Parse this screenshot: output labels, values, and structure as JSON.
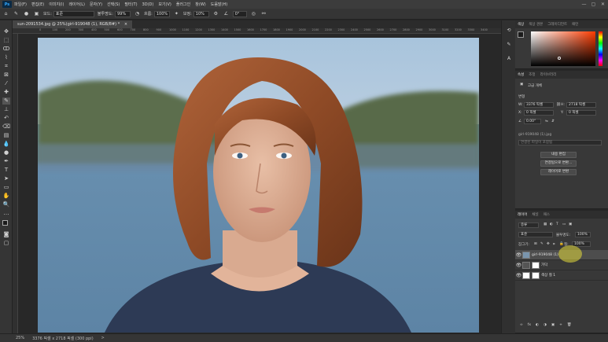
{
  "app": {
    "logo": "Ps"
  },
  "menubar": {
    "items": [
      "파일(F)",
      "편집(E)",
      "이미지(I)",
      "레이어(L)",
      "문자(Y)",
      "선택(S)",
      "필터(T)",
      "3D(D)",
      "보기(V)",
      "플러그인",
      "창(W)",
      "도움말(H)"
    ],
    "window_controls": [
      "—",
      "▢",
      "✕"
    ]
  },
  "optionsbar": {
    "mode_label": "모드:",
    "mode_value": "표준",
    "opacity_label": "불투명도:",
    "opacity_value": "99%",
    "flow_label": "흐름:",
    "flow_value": "100%",
    "smoothing_label": "보정:",
    "smoothing_value": "10%",
    "angle_value": "0°"
  },
  "document": {
    "tab_title": "sun-2091534.jpg @ 25%(girl-919048 (1), RGB/8#) *",
    "tab_close": "×",
    "ruler_ticks": [
      "0",
      "100",
      "200",
      "300",
      "400",
      "500",
      "600",
      "700",
      "800",
      "900",
      "1000",
      "1100",
      "1200",
      "1300",
      "1400",
      "1500",
      "1600",
      "1700",
      "1800",
      "1900",
      "2000",
      "2100",
      "2200",
      "2300",
      "2400",
      "2500",
      "2600",
      "2700",
      "2800",
      "2900",
      "3000",
      "3100",
      "3200",
      "3300",
      "3400"
    ]
  },
  "status": {
    "zoom": "25%",
    "doc_info": "3376 픽셀 x 2718 픽셀 (300 ppi)",
    "arrow": ">"
  },
  "color_panel": {
    "tabs": [
      "색상",
      "색상 견본",
      "그레이디언트",
      "패턴"
    ],
    "active_tab": 0,
    "hue_colors": [
      "#ff0000",
      "#ffff00",
      "#00ff00",
      "#00ffff",
      "#0000ff",
      "#ff00ff",
      "#ff0000"
    ],
    "base_hue": "#ff3b00",
    "fg_color": "#1a1a1a",
    "bg_color": "#8b2e1a"
  },
  "properties_panel": {
    "tabs": [
      "속성",
      "조정",
      "라이브러리"
    ],
    "active_tab": 0,
    "object_type": "고급 개체",
    "section_label": "변형",
    "w_label": "W:",
    "w_value": "3376 픽셀",
    "h_label": "H:",
    "h_value": "2718 픽셀",
    "x_label": "X:",
    "x_value": "0 픽셀",
    "y_label": "Y:",
    "y_value": "0 픽셀",
    "angle_value": "0.00°",
    "file_label": "girl-919048 (1).jpg",
    "embed_note": "연결된 파일이 포함됨",
    "buttons": [
      "내용 편집",
      "연결됨으로 변환...",
      "레이어로 변환"
    ]
  },
  "layers_panel": {
    "tabs": [
      "레이어",
      "채널",
      "패스"
    ],
    "active_tab": 0,
    "kind_filter": "종류",
    "blend_mode": "표준",
    "opacity_label": "불투명도:",
    "opacity_value": "100%",
    "lock_label": "잠그기:",
    "fill_label": "칠:",
    "fill_value": "100%",
    "layers": [
      {
        "name": "girl-919048 (1)",
        "selected": true
      },
      {
        "name": "가닥",
        "selected": false
      },
      {
        "name": "색상 칠 1",
        "selected": false
      }
    ],
    "bottom_icons": [
      "∞",
      "fx",
      "◐",
      "◑",
      "▣",
      "+",
      "🗑"
    ]
  }
}
